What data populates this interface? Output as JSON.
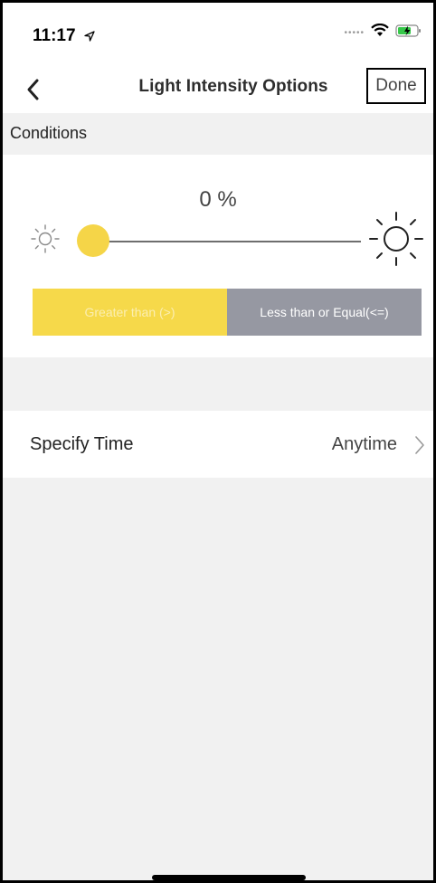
{
  "status_bar": {
    "time": "11:17",
    "location_icon": "location-arrow-icon",
    "signal_icon": "signal-dots-icon",
    "wifi_icon": "wifi-icon",
    "battery_icon": "battery-charging-icon"
  },
  "nav": {
    "back_icon": "chevron-left-icon",
    "title": "Light Intensity Options",
    "done_label": "Done"
  },
  "conditions": {
    "section_label": "Conditions",
    "slider": {
      "value_text": "0 %",
      "value": 0,
      "min_icon": "sun-small-icon",
      "max_icon": "sun-large-icon"
    },
    "segments": {
      "greater_label": "Greater than (>)",
      "less_equal_label": "Less than or Equal(<=)",
      "selected": "greater"
    }
  },
  "time": {
    "label": "Specify Time",
    "value": "Anytime",
    "chevron_icon": "chevron-right-icon"
  },
  "colors": {
    "accent_yellow": "#f6d94a",
    "segment_gray": "#9698a2",
    "background": "#f1f1f1"
  }
}
